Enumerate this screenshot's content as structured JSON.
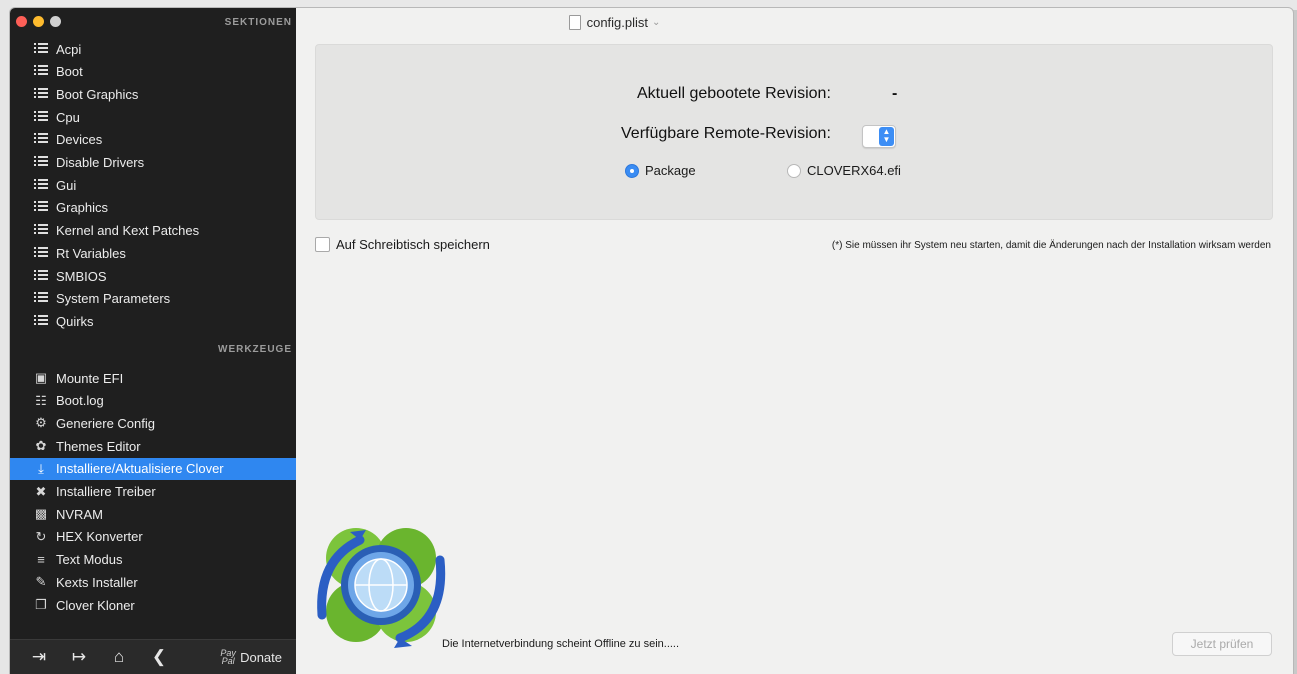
{
  "window": {
    "title": "config.plist"
  },
  "sidebar": {
    "sections_header": "SEKTIONEN",
    "sections": [
      {
        "label": "Acpi"
      },
      {
        "label": "Boot"
      },
      {
        "label": "Boot Graphics"
      },
      {
        "label": "Cpu"
      },
      {
        "label": "Devices"
      },
      {
        "label": "Disable Drivers"
      },
      {
        "label": "Gui"
      },
      {
        "label": "Graphics"
      },
      {
        "label": "Kernel and Kext Patches"
      },
      {
        "label": "Rt Variables"
      },
      {
        "label": "SMBIOS"
      },
      {
        "label": "System Parameters"
      },
      {
        "label": "Quirks"
      }
    ],
    "tools_header": "WERKZEUGE",
    "tools": [
      {
        "label": "Mounte EFI",
        "icon": "disk-icon"
      },
      {
        "label": "Boot.log",
        "icon": "log-icon"
      },
      {
        "label": "Generiere Config",
        "icon": "gears-icon"
      },
      {
        "label": "Themes Editor",
        "icon": "palette-icon"
      },
      {
        "label": "Installiere/Aktualisiere Clover",
        "icon": "download-icon",
        "active": true
      },
      {
        "label": "Installiere Treiber",
        "icon": "tools-icon"
      },
      {
        "label": "NVRAM",
        "icon": "chip-icon"
      },
      {
        "label": "HEX Konverter",
        "icon": "refresh-icon"
      },
      {
        "label": "Text Modus",
        "icon": "text-icon"
      },
      {
        "label": "Kexts Installer",
        "icon": "kext-icon"
      },
      {
        "label": "Clover Kloner",
        "icon": "copy-icon"
      }
    ],
    "footer": {
      "donate_label": "Donate",
      "paypal_label": "Pay Pal"
    }
  },
  "main": {
    "current_revision_label": "Aktuell gebootete Revision:",
    "current_revision_value": "-",
    "remote_revision_label": "Verfügbare Remote-Revision:",
    "radio_package": "Package",
    "radio_clover": "CLOVERX64.efi",
    "selected_radio": "Package",
    "save_desktop_label": "Auf Schreibtisch speichern",
    "restart_note": "(*) Sie müssen ihr System neu starten, damit die Änderungen nach der Installation wirksam werden",
    "status_text": "Die Internetverbindung scheint Offline zu sein.....",
    "check_button": "Jetzt prüfen"
  },
  "colors": {
    "sidebar_bg": "#1f1f1f",
    "accent": "#2f87f0",
    "window_bg": "#f1f1f0"
  }
}
